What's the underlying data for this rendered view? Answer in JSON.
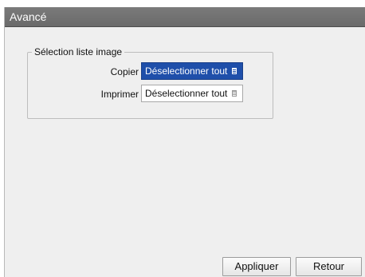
{
  "window": {
    "title": "Avancé"
  },
  "image_list_group": {
    "legend": "Sélection liste image",
    "rows": [
      {
        "label": "Copier",
        "value": "Déselectionner tout",
        "selected": true
      },
      {
        "label": "Imprimer",
        "value": "Déselectionner tout",
        "selected": false
      }
    ]
  },
  "footer": {
    "apply_label": "Appliquer",
    "back_label": "Retour"
  },
  "colors": {
    "titlebar": "#707070",
    "selection": "#1f4faa",
    "window_background": "#efefef"
  },
  "icons": {
    "combo_indicator": "list-icon"
  }
}
